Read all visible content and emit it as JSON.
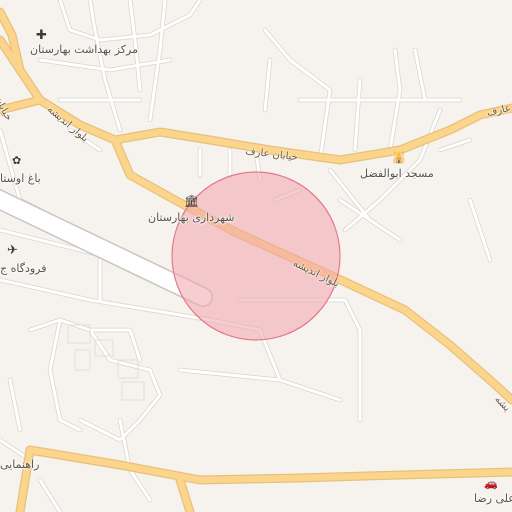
{
  "map": {
    "colors": {
      "background": "#f6f3ef",
      "minor_road": "#ffffff",
      "minor_road_casing": "#d9d4cd",
      "major_road": "#fbd58c",
      "major_road_casing": "#e9c07a",
      "runway": "#ffffff",
      "runway_casing": "#c9c6c2",
      "highlight_fill": "#f3a4ac",
      "highlight_stroke": "#e27a86"
    },
    "place_labels": {
      "health_center": "مرکز بهداشت بهارستان",
      "municipality": "شهرداری بهارستان",
      "mosque": "مسجد ابوالفضل",
      "garden": "باغ اوستا",
      "airport": "فرودگاه ج",
      "guidance": "راهنمایی",
      "ali_reza": "علی رضا"
    },
    "road_labels": {
      "khiaban_aref": "خیابان عارف",
      "aref_east": "عارف",
      "bolvar_andisheh_main": "بلوار اندیشه",
      "bolvar_andisheh_west": "بلوار اندیشه",
      "andisheh_south": "یشه",
      "khiaban_west": "خیابان"
    },
    "icons": {
      "health": "cross-icon",
      "municipality": "government-building-icon",
      "mosque": "mosque-icon",
      "garden": "garden-icon",
      "airport": "airplane-icon",
      "car": "car-icon"
    },
    "highlight": {
      "shape": "circle",
      "label": "selected-area"
    }
  }
}
